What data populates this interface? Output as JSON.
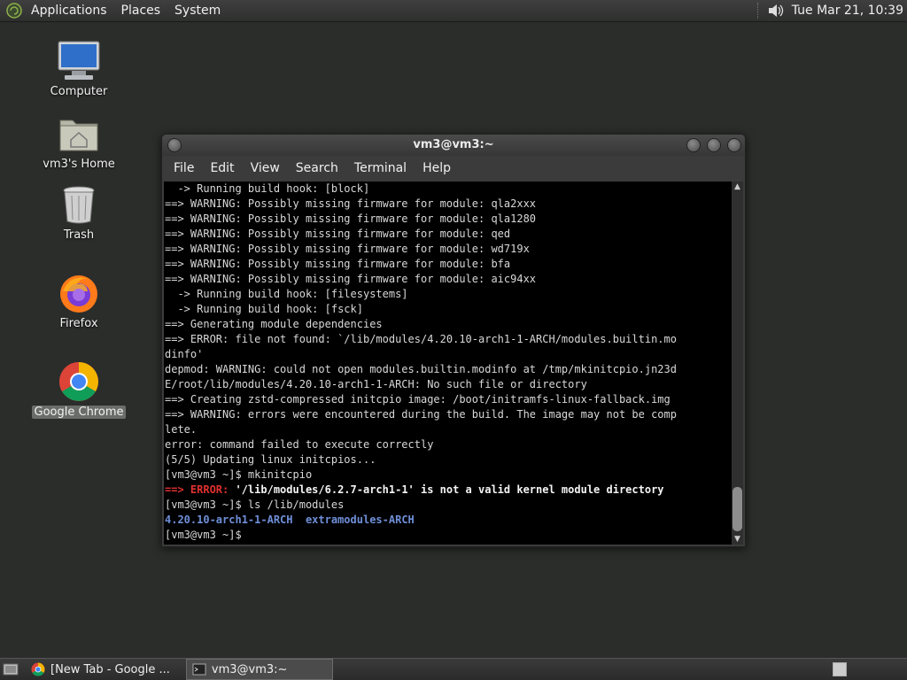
{
  "top_panel": {
    "menus": [
      "Applications",
      "Places",
      "System"
    ],
    "clock": "Tue Mar 21, 10:39",
    "volume_icon": "speaker-icon"
  },
  "desktop": {
    "icons": [
      {
        "label": "Computer",
        "icon": "computer-icon"
      },
      {
        "label": "vm3's Home",
        "icon": "home-folder-icon"
      },
      {
        "label": "Trash",
        "icon": "trash-icon"
      },
      {
        "label": "Firefox",
        "icon": "firefox-icon"
      },
      {
        "label": "Google Chrome",
        "icon": "chrome-icon"
      }
    ]
  },
  "terminal": {
    "title": "vm3@vm3:~",
    "menus": [
      "File",
      "Edit",
      "View",
      "Search",
      "Terminal",
      "Help"
    ],
    "lines": [
      "  -> Running build hook: [block]",
      "==> WARNING: Possibly missing firmware for module: qla2xxx",
      "==> WARNING: Possibly missing firmware for module: qla1280",
      "==> WARNING: Possibly missing firmware for module: qed",
      "==> WARNING: Possibly missing firmware for module: wd719x",
      "==> WARNING: Possibly missing firmware for module: bfa",
      "==> WARNING: Possibly missing firmware for module: aic94xx",
      "  -> Running build hook: [filesystems]",
      "  -> Running build hook: [fsck]",
      "==> Generating module dependencies",
      "==> ERROR: file not found: `/lib/modules/4.20.10-arch1-1-ARCH/modules.builtin.mo",
      "dinfo'",
      "depmod: WARNING: could not open modules.builtin.modinfo at /tmp/mkinitcpio.jn23d",
      "E/root/lib/modules/4.20.10-arch1-1-ARCH: No such file or directory",
      "==> Creating zstd-compressed initcpio image: /boot/initramfs-linux-fallback.img",
      "==> WARNING: errors were encountered during the build. The image may not be comp",
      "lete.",
      "error: command failed to execute correctly",
      "(5/5) Updating linux initcpios...",
      "[vm3@vm3 ~]$ mkinitcpio"
    ],
    "error_prefix": "==> ERROR:",
    "error_text": " '/lib/modules/6.2.7-arch1-1' is not a valid kernel module directory",
    "ls_prompt": "[vm3@vm3 ~]$ ls /lib/modules",
    "ls_dir1": "4.20.10-arch1-1-ARCH",
    "ls_dir2": "extramodules-ARCH",
    "final_prompt": "[vm3@vm3 ~]$"
  },
  "taskbar": {
    "tasks": [
      {
        "label": "[New Tab - Google ...",
        "icon": "chrome-icon"
      },
      {
        "label": "vm3@vm3:~",
        "icon": "terminal-icon"
      }
    ]
  }
}
